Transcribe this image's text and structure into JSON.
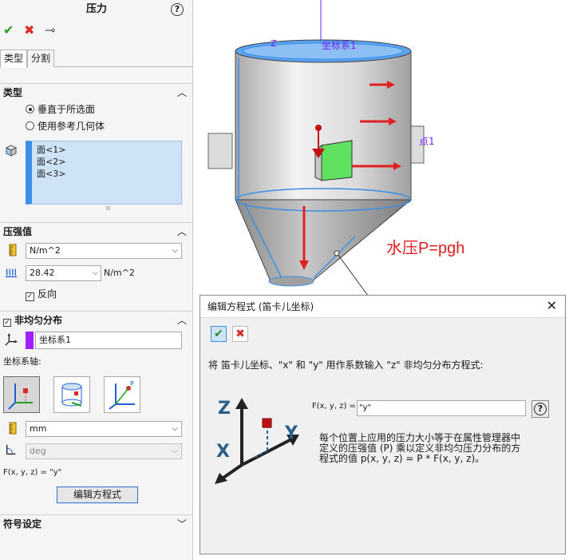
{
  "property_manager": {
    "title": "压力",
    "help": "?",
    "tabs": [
      "类型",
      "分割"
    ],
    "type_section": {
      "heading": "类型",
      "options": [
        "垂直于所选面",
        "使用参考几何体"
      ],
      "selected_option": 0,
      "faces": [
        "面<1>",
        "面<2>",
        "面<3>"
      ]
    },
    "pressure_section": {
      "heading": "压强值",
      "unit": "N/m^2",
      "value": "28.42",
      "value_unit": "N/m^2",
      "reverse_label": "反向",
      "reverse_checked": true
    },
    "nonuniform_section": {
      "heading": "非均匀分布",
      "checked": true,
      "coord_system": "坐标系1",
      "axis_label": "坐标系轴:",
      "length_unit": "mm",
      "angle_unit": "deg",
      "equation": "F(x, y, z) = \"y\"",
      "edit_button": "编辑方程式"
    },
    "symbol_section": {
      "heading": "符号设定"
    }
  },
  "graphics": {
    "coord_label": "坐标系1",
    "z_tag": "Z",
    "point_label": "点1",
    "annotation": "水压P=pgh",
    "colors": {
      "pressure_arrow": "#e02020",
      "tank_body": "#d6d6d6",
      "selected_edge": "#3a8fe6",
      "coord": "#7020ff",
      "green_face": "#5fe05f"
    }
  },
  "dialog": {
    "title": "编辑方程式 (笛卡儿坐标)",
    "close": "✕",
    "instruction": "将 笛卡儿坐标、\"x\" 和 \"y\" 用作系数输入 \"z\" 非均匀分布方程式:",
    "fx_label": "F(x, y, z) =",
    "fx_value": "\"y\"",
    "help": "?",
    "desc_lines": [
      "每个位置上应用的压力大小等于在属性管理器中",
      "定义的压强值 (P) 乘以定义非均匀压力分布的方",
      "程式的值 p(x, y, z) = P * F(x, y, z)。"
    ],
    "axes": {
      "z": "Z",
      "y": "Y",
      "x": "X"
    }
  }
}
